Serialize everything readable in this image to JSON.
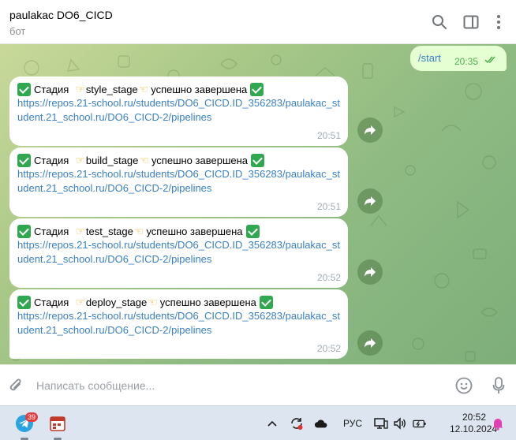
{
  "header": {
    "title": "paulakac DO6_CICD",
    "subtitle": "бот"
  },
  "icons": {
    "search": "search-icon",
    "side_panel": "side-panel-icon",
    "more": "more-vertical-icon",
    "attach": "paperclip-icon",
    "emoji": "emoji-icon",
    "mic": "microphone-icon",
    "forward": "forward-arrow-icon"
  },
  "outgoing": {
    "text": "/start",
    "time": "20:35"
  },
  "messages": [
    {
      "prefix": "Стадия",
      "stage": "style_stage",
      "suffix": "успешно завершена",
      "link": "https://repos.21-school.ru/students/DO6_CICD.ID_356283/paulakac_student.21_school.ru/DO6_CICD-2/pipelines",
      "time": "20:51"
    },
    {
      "prefix": "Стадия",
      "stage": "build_stage",
      "suffix": "успешно завершена",
      "link": "https://repos.21-school.ru/students/DO6_CICD.ID_356283/paulakac_student.21_school.ru/DO6_CICD-2/pipelines",
      "time": "20:51"
    },
    {
      "prefix": "Стадия",
      "stage": "test_stage",
      "suffix": "успешно завершена",
      "link": "https://repos.21-school.ru/students/DO6_CICD.ID_356283/paulakac_student.21_school.ru/DO6_CICD-2/pipelines",
      "time": "20:52"
    },
    {
      "prefix": "Стадия",
      "stage": "deploy_stage",
      "suffix": "успешно завершена",
      "link": "https://repos.21-school.ru/students/DO6_CICD.ID_356283/paulakac_student.21_school.ru/DO6_CICD-2/pipelines",
      "time": "20:52"
    }
  ],
  "composer": {
    "placeholder": "Написать сообщение..."
  },
  "taskbar": {
    "telegram_badge": "39",
    "language": "РУС",
    "time": "20:52",
    "date": "12.10.2024"
  },
  "colors": {
    "accent_link": "#3a80c6",
    "outgoing_bubble": "#e6ffd2",
    "read_checks": "#4fae4e",
    "success_check": "#2fa84f"
  }
}
